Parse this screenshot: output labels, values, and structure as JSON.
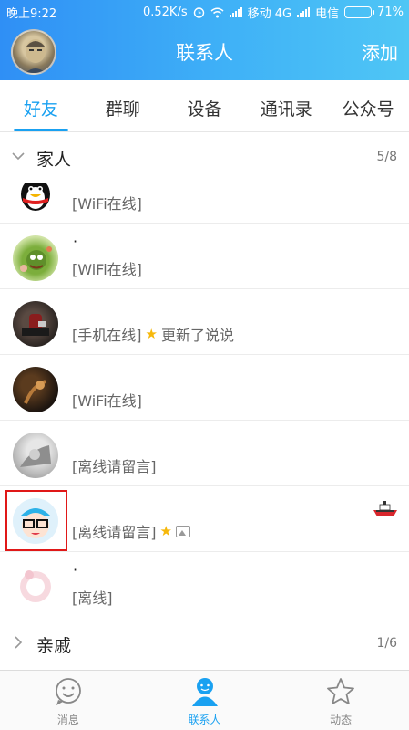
{
  "status_bar": {
    "time": "晚上9:22",
    "net_speed": "0.52K/s",
    "carrier1": "移动 4G",
    "carrier2": "电信",
    "battery": "71%"
  },
  "header": {
    "title": "联系人",
    "add_label": "添加"
  },
  "tabs": [
    {
      "label": "好友",
      "active": true
    },
    {
      "label": "群聊"
    },
    {
      "label": "设备"
    },
    {
      "label": "通讯录"
    },
    {
      "label": "公众号"
    }
  ],
  "groups": [
    {
      "name": "家人",
      "count": "5/8",
      "expanded": true
    },
    {
      "name": "亲戚",
      "count": "1/6",
      "expanded": false
    }
  ],
  "contacts": [
    {
      "name": "",
      "status": "[WiFi在线]",
      "avatar": "penguin"
    },
    {
      "name": "·",
      "status": "[WiFi在线]",
      "avatar": "green-cartoon"
    },
    {
      "name": "",
      "status": "[手机在线]",
      "extra": "更新了说说",
      "avatar": "dark-photo"
    },
    {
      "name": "",
      "status": "[WiFi在线]",
      "avatar": "dark-photo-2"
    },
    {
      "name": "",
      "status": "[离线请留言]",
      "avatar": "gray-photo"
    },
    {
      "name": "",
      "status": "[离线请留言]",
      "avatar": "cartoon-kid",
      "highlighted": true,
      "badge": "boat-icon"
    },
    {
      "name": "·",
      "status": "[离线]",
      "avatar": "pink-sketch"
    }
  ],
  "bottom_nav": [
    {
      "label": "消息",
      "icon": "smile-icon"
    },
    {
      "label": "联系人",
      "icon": "person-icon",
      "active": true
    },
    {
      "label": "动态",
      "icon": "star-icon"
    }
  ],
  "colors": {
    "accent": "#1aa1f1",
    "header_start": "#2f8ff5",
    "header_end": "#4fc6f5",
    "highlight_box": "#e01818"
  }
}
